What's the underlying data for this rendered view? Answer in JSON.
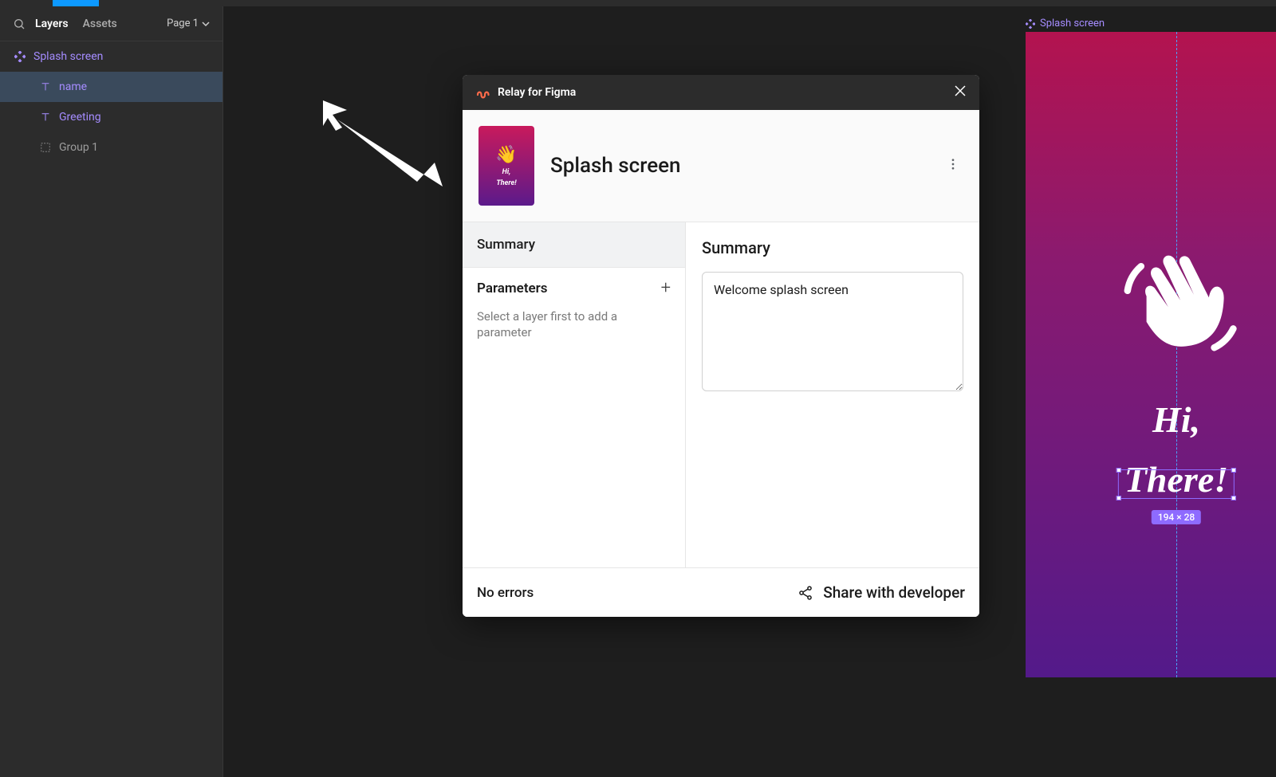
{
  "sidebar": {
    "tabs": {
      "layers": "Layers",
      "assets": "Assets"
    },
    "page_label": "Page 1",
    "layers": [
      {
        "name": "Splash screen",
        "type": "component"
      },
      {
        "name": "name",
        "type": "text",
        "selected": true
      },
      {
        "name": "Greeting",
        "type": "text"
      },
      {
        "name": "Group 1",
        "type": "group"
      }
    ]
  },
  "plugin": {
    "title": "Relay for Figma",
    "component_name": "Splash screen",
    "thumb_hi": "Hi,",
    "thumb_there": "There!",
    "left": {
      "summary": "Summary",
      "parameters": "Parameters",
      "hint": "Select a layer first to add a parameter"
    },
    "right": {
      "summary_title": "Summary",
      "summary_text": "Welcome splash screen"
    },
    "footer": {
      "errors": "No errors",
      "share": "Share with developer"
    }
  },
  "canvas": {
    "frame_label": "Splash screen",
    "hi": "Hi,",
    "there": "There!",
    "size_badge": "194 × 28"
  }
}
